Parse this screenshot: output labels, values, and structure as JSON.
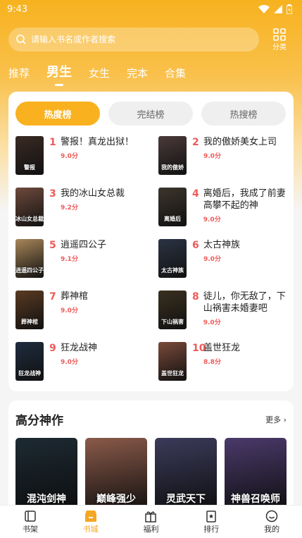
{
  "status": {
    "time": "9:43"
  },
  "search": {
    "placeholder": "请输入书名或作者搜索"
  },
  "category_label": "分类",
  "tabs": [
    {
      "label": "推荐"
    },
    {
      "label": "男生"
    },
    {
      "label": "女生"
    },
    {
      "label": "完本"
    },
    {
      "label": "合集"
    }
  ],
  "rank_tabs": [
    {
      "label": "热度榜"
    },
    {
      "label": "完结榜"
    },
    {
      "label": "热搜榜"
    }
  ],
  "rank_items": [
    {
      "rank": "1",
      "title": "警报！真龙出狱！",
      "score": "9.0分",
      "cover_text": "警报",
      "cover_color": "#3a2a24"
    },
    {
      "rank": "2",
      "title": "我的傲娇美女上司",
      "score": "9.0分",
      "cover_text": "我的傲娇",
      "cover_color": "#4b3a3a"
    },
    {
      "rank": "3",
      "title": "我的冰山女总裁",
      "score": "9.2分",
      "cover_text": "冰山女总裁",
      "cover_color": "#6e4a3c"
    },
    {
      "rank": "4",
      "title": "离婚后，我成了前妻高攀不起的神",
      "score": "9.0分",
      "cover_text": "离婚后",
      "cover_color": "#3c352c"
    },
    {
      "rank": "5",
      "title": "逍遥四公子",
      "score": "9.1分",
      "cover_text": "逍遥四公子",
      "cover_color": "#a8865a"
    },
    {
      "rank": "6",
      "title": "太古神族",
      "score": "9.0分",
      "cover_text": "太古神族",
      "cover_color": "#2b3444"
    },
    {
      "rank": "7",
      "title": "葬神棺",
      "score": "9.0分",
      "cover_text": "葬神棺",
      "cover_color": "#5a3a22"
    },
    {
      "rank": "8",
      "title": "徒儿，你无敌了，下山祸害未婚妻吧",
      "score": "9.0分",
      "cover_text": "下山祸害",
      "cover_color": "#3a3020"
    },
    {
      "rank": "9",
      "title": "狂龙战神",
      "score": "9.0分",
      "cover_text": "狂龙战神",
      "cover_color": "#1e2c3e"
    },
    {
      "rank": "10",
      "title": "盖世狂龙",
      "score": "8.8分",
      "cover_text": "盖世狂龙",
      "cover_color": "#7a4a3a"
    }
  ],
  "high_section": {
    "title": "高分神作",
    "more": "更多",
    "books": [
      {
        "cover_text": "混沌剑神",
        "cover_color": "#1d2a33"
      },
      {
        "cover_text": "巅峰强少",
        "cover_color": "#8a5a4a"
      },
      {
        "cover_text": "灵武天下",
        "cover_color": "#3b3b5a"
      },
      {
        "cover_text": "神兽召唤师",
        "cover_color": "#4a3a6a"
      }
    ]
  },
  "bottom_nav": [
    {
      "label": "书架",
      "icon": "book-icon"
    },
    {
      "label": "书城",
      "icon": "store-icon"
    },
    {
      "label": "福利",
      "icon": "gift-icon"
    },
    {
      "label": "排行",
      "icon": "ranking-icon"
    },
    {
      "label": "我的",
      "icon": "profile-icon"
    }
  ]
}
